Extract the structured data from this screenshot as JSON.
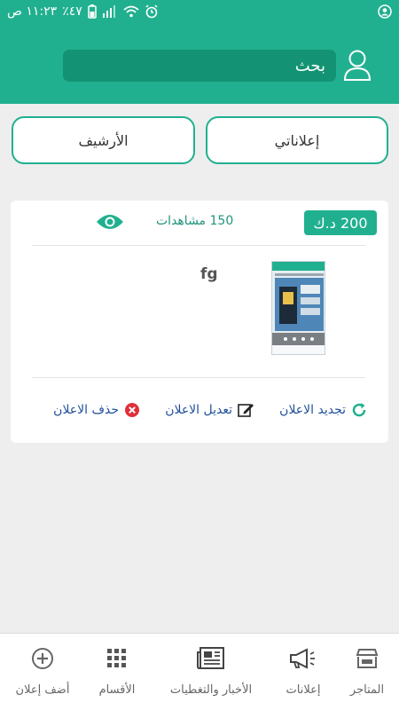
{
  "status_bar": {
    "time": "١١:٢٣ ص",
    "battery": "٪٤٧"
  },
  "search": {
    "placeholder": "بحث"
  },
  "tabs": {
    "my_ads": "إعلاناتي",
    "archive": "الأرشيف"
  },
  "ad": {
    "price": "200 د.ك",
    "views": "150 مشاهدات",
    "title": "fg",
    "actions": {
      "renew": "تجديد الاعلان",
      "edit": "تعديل الاعلان",
      "delete": "حذف الاعلان"
    }
  },
  "bottom_nav": {
    "stores": "المتاجر",
    "ads": "إعلانات",
    "news": "الأخبار والتغطيات",
    "categories": "الأقسام",
    "add_ad": "أضف إعلان"
  },
  "colors": {
    "primary": "#21b08f",
    "primary_dark": "#139373",
    "link_blue": "#1f4f9a",
    "delete_red": "#e0303a"
  },
  "icons": [
    "user-icon",
    "eye-icon",
    "refresh-icon",
    "edit-icon",
    "delete-icon",
    "store-icon",
    "megaphone-icon",
    "newspaper-icon",
    "grid-icon",
    "plus-circle-icon"
  ]
}
